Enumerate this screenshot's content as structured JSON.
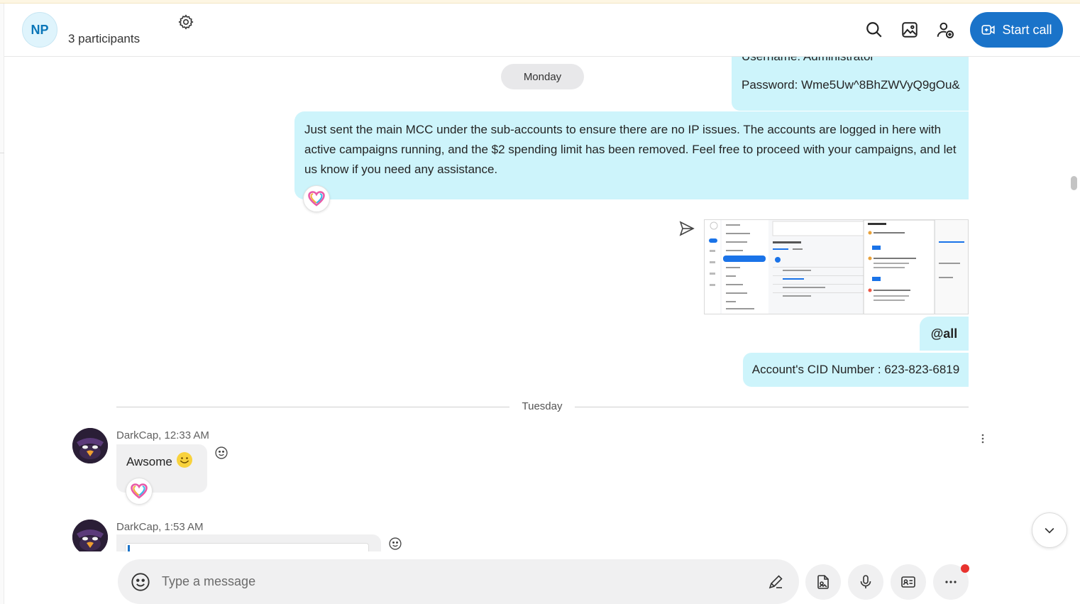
{
  "header": {
    "avatar_initials": "NP",
    "participants": "3 participants",
    "start_call_label": "Start call",
    "accent_color": "#1a73c9"
  },
  "messages_out": {
    "credentials_username": "Username: Administrator",
    "credentials_password": "Password: Wme5Uw^8BhZWVyQ9gOu&",
    "mcc_message": "Just sent the main MCC under the sub-accounts to ensure there are no IP issues. The accounts are logged in here with active campaigns running, and the $2 spending limit has been removed. Feel free to proceed with your campaigns, and let us know if you need any assistance.",
    "mention": "@all",
    "cid_message": "Account's CID Number : 623-823-6819",
    "bubble_color": "#cdf4fb"
  },
  "day_labels": {
    "monday": "Monday",
    "tuesday": "Tuesday"
  },
  "messages_in": [
    {
      "sender_meta": "DarkCap, 12:33 AM",
      "text": "Awsome"
    },
    {
      "sender_meta": "DarkCap, 1:53 AM",
      "text": ""
    }
  ],
  "composer": {
    "placeholder": "Type a message"
  },
  "icons": {
    "header": [
      "settings-icon",
      "search-icon",
      "gallery-icon",
      "add-person-icon",
      "video-call-icon"
    ],
    "composer": [
      "emoji-icon",
      "pen-icon",
      "file-icon",
      "mic-icon",
      "contact-card-icon",
      "more-icon"
    ]
  }
}
